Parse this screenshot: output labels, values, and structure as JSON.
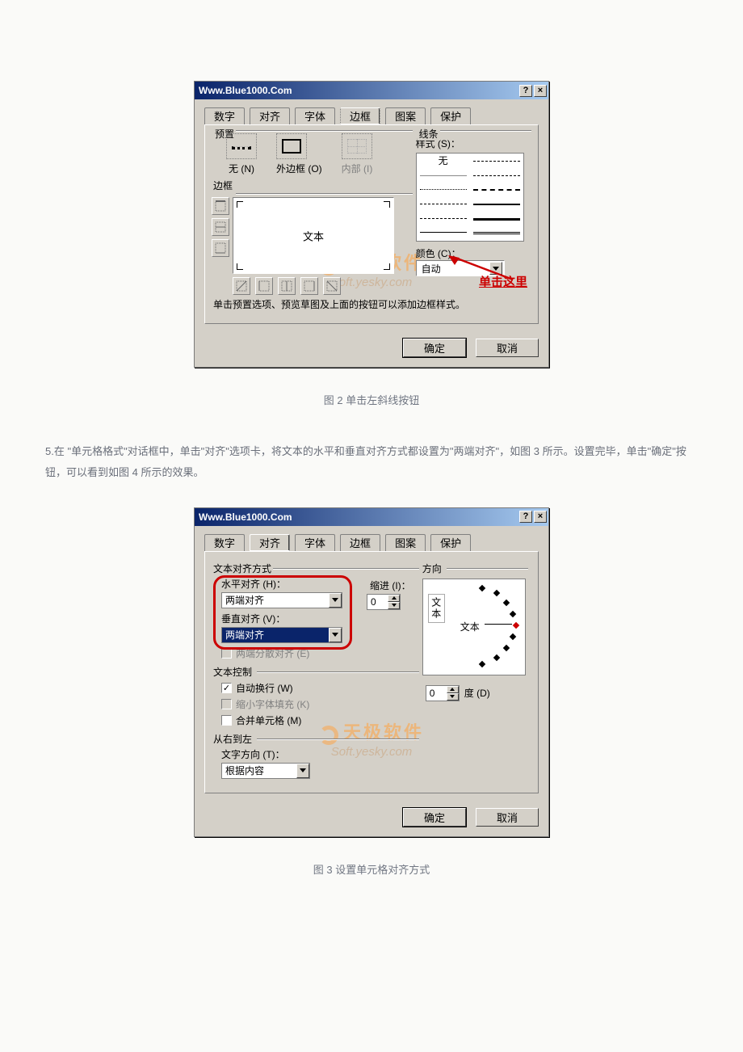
{
  "dialog_title": "Www.Blue1000.Com",
  "help_btn": "?",
  "close_btn": "×",
  "tabs": [
    "数字",
    "对齐",
    "字体",
    "边框",
    "图案",
    "保护"
  ],
  "fig2": {
    "preset_group": "预置",
    "line_group": "线条",
    "preset_none": "无 (N)",
    "preset_outline": "外边框 (O)",
    "preset_inside": "内部 (I)",
    "border_group": "边框",
    "preview_text": "文本",
    "style_label": "样式 (S)：",
    "style_none": "无",
    "color_label": "颜色 (C)：",
    "color_auto": "自动",
    "hint": "单击预置选项、预览草图及上面的按钮可以添加边框样式。",
    "annotation": "单击这里"
  },
  "fig3": {
    "align_group": "文本对齐方式",
    "direction_group": "方向",
    "h_align_label": "水平对齐 (H)：",
    "h_align_value": "两端对齐",
    "indent_label": "缩进 (I)：",
    "indent_value": "0",
    "v_align_label": "垂直对齐 (V)：",
    "v_align_value": "两端对齐",
    "distributed": "两端分散对齐 (E)",
    "control_group": "文本控制",
    "wrap": "自动换行 (W)",
    "shrink": "缩小字体填充 (K)",
    "merge": "合并单元格 (M)",
    "rtl_group": "从右到左",
    "textdir_label": "文字方向 (T)：",
    "textdir_value": "根据内容",
    "orient_text": "文本",
    "orient_v": "文本",
    "deg_value": "0",
    "deg_label": "度 (D)"
  },
  "ok": "确定",
  "cancel": "取消",
  "caption2": "图 2  单击左斜线按钮",
  "para": "5.在 \"单元格格式\"对话框中，单击\"对齐\"选项卡，将文本的水平和垂直对齐方式都设置为\"两端对齐\"，如图 3 所示。设置完毕，单击\"确定\"按钮，可以看到如图 4 所示的效果。",
  "caption3": "图 3  设置单元格对齐方式",
  "watermark1": "天极软件",
  "watermark2": "Soft.yesky.com"
}
